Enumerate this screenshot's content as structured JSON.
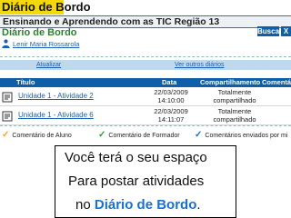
{
  "title_badge": "Diário de Bordo",
  "header": {
    "title": "Ensinando e Aprendendo com as TIC Região 13",
    "busca_label": "Busca",
    "close_label": "X"
  },
  "page_heading": "Diário de Bordo",
  "user": {
    "name": "Lenir Maria Rossarola",
    "icon": "user-icon"
  },
  "actions": {
    "atualizar": "Atualizar",
    "ver_outros": "Ver outros diários"
  },
  "table": {
    "headers": {
      "titulo": "Título",
      "data": "Data",
      "compartilhamento": "Compartilhamento",
      "comentarios": "Comentá"
    },
    "rows": [
      {
        "title": "Unidade 1 - Atividade 2",
        "date": "22/03/2009",
        "time": "14:10:00",
        "share_1": "Totalmente",
        "share_2": "compartilhado"
      },
      {
        "title": "Unidade 1 - Atividade 6",
        "date": "22/03/2009",
        "time": "14:11:07",
        "share_1": "Totalmente",
        "share_2": "compartilhado"
      }
    ]
  },
  "legend": [
    {
      "label": "Comentário de Aluno",
      "color": "#f5a623"
    },
    {
      "label": "Comentário de Formador",
      "color": "#2e9d3a"
    },
    {
      "label": "Comentários enviados por mi",
      "color": "#1a6fd1"
    }
  ],
  "callout": {
    "line1": "Você terá o seu espaço",
    "line2": "Para postar atividades",
    "line3_prefix": "no ",
    "line3_highlight": "Diário de Bordo",
    "line3_suffix": "."
  }
}
